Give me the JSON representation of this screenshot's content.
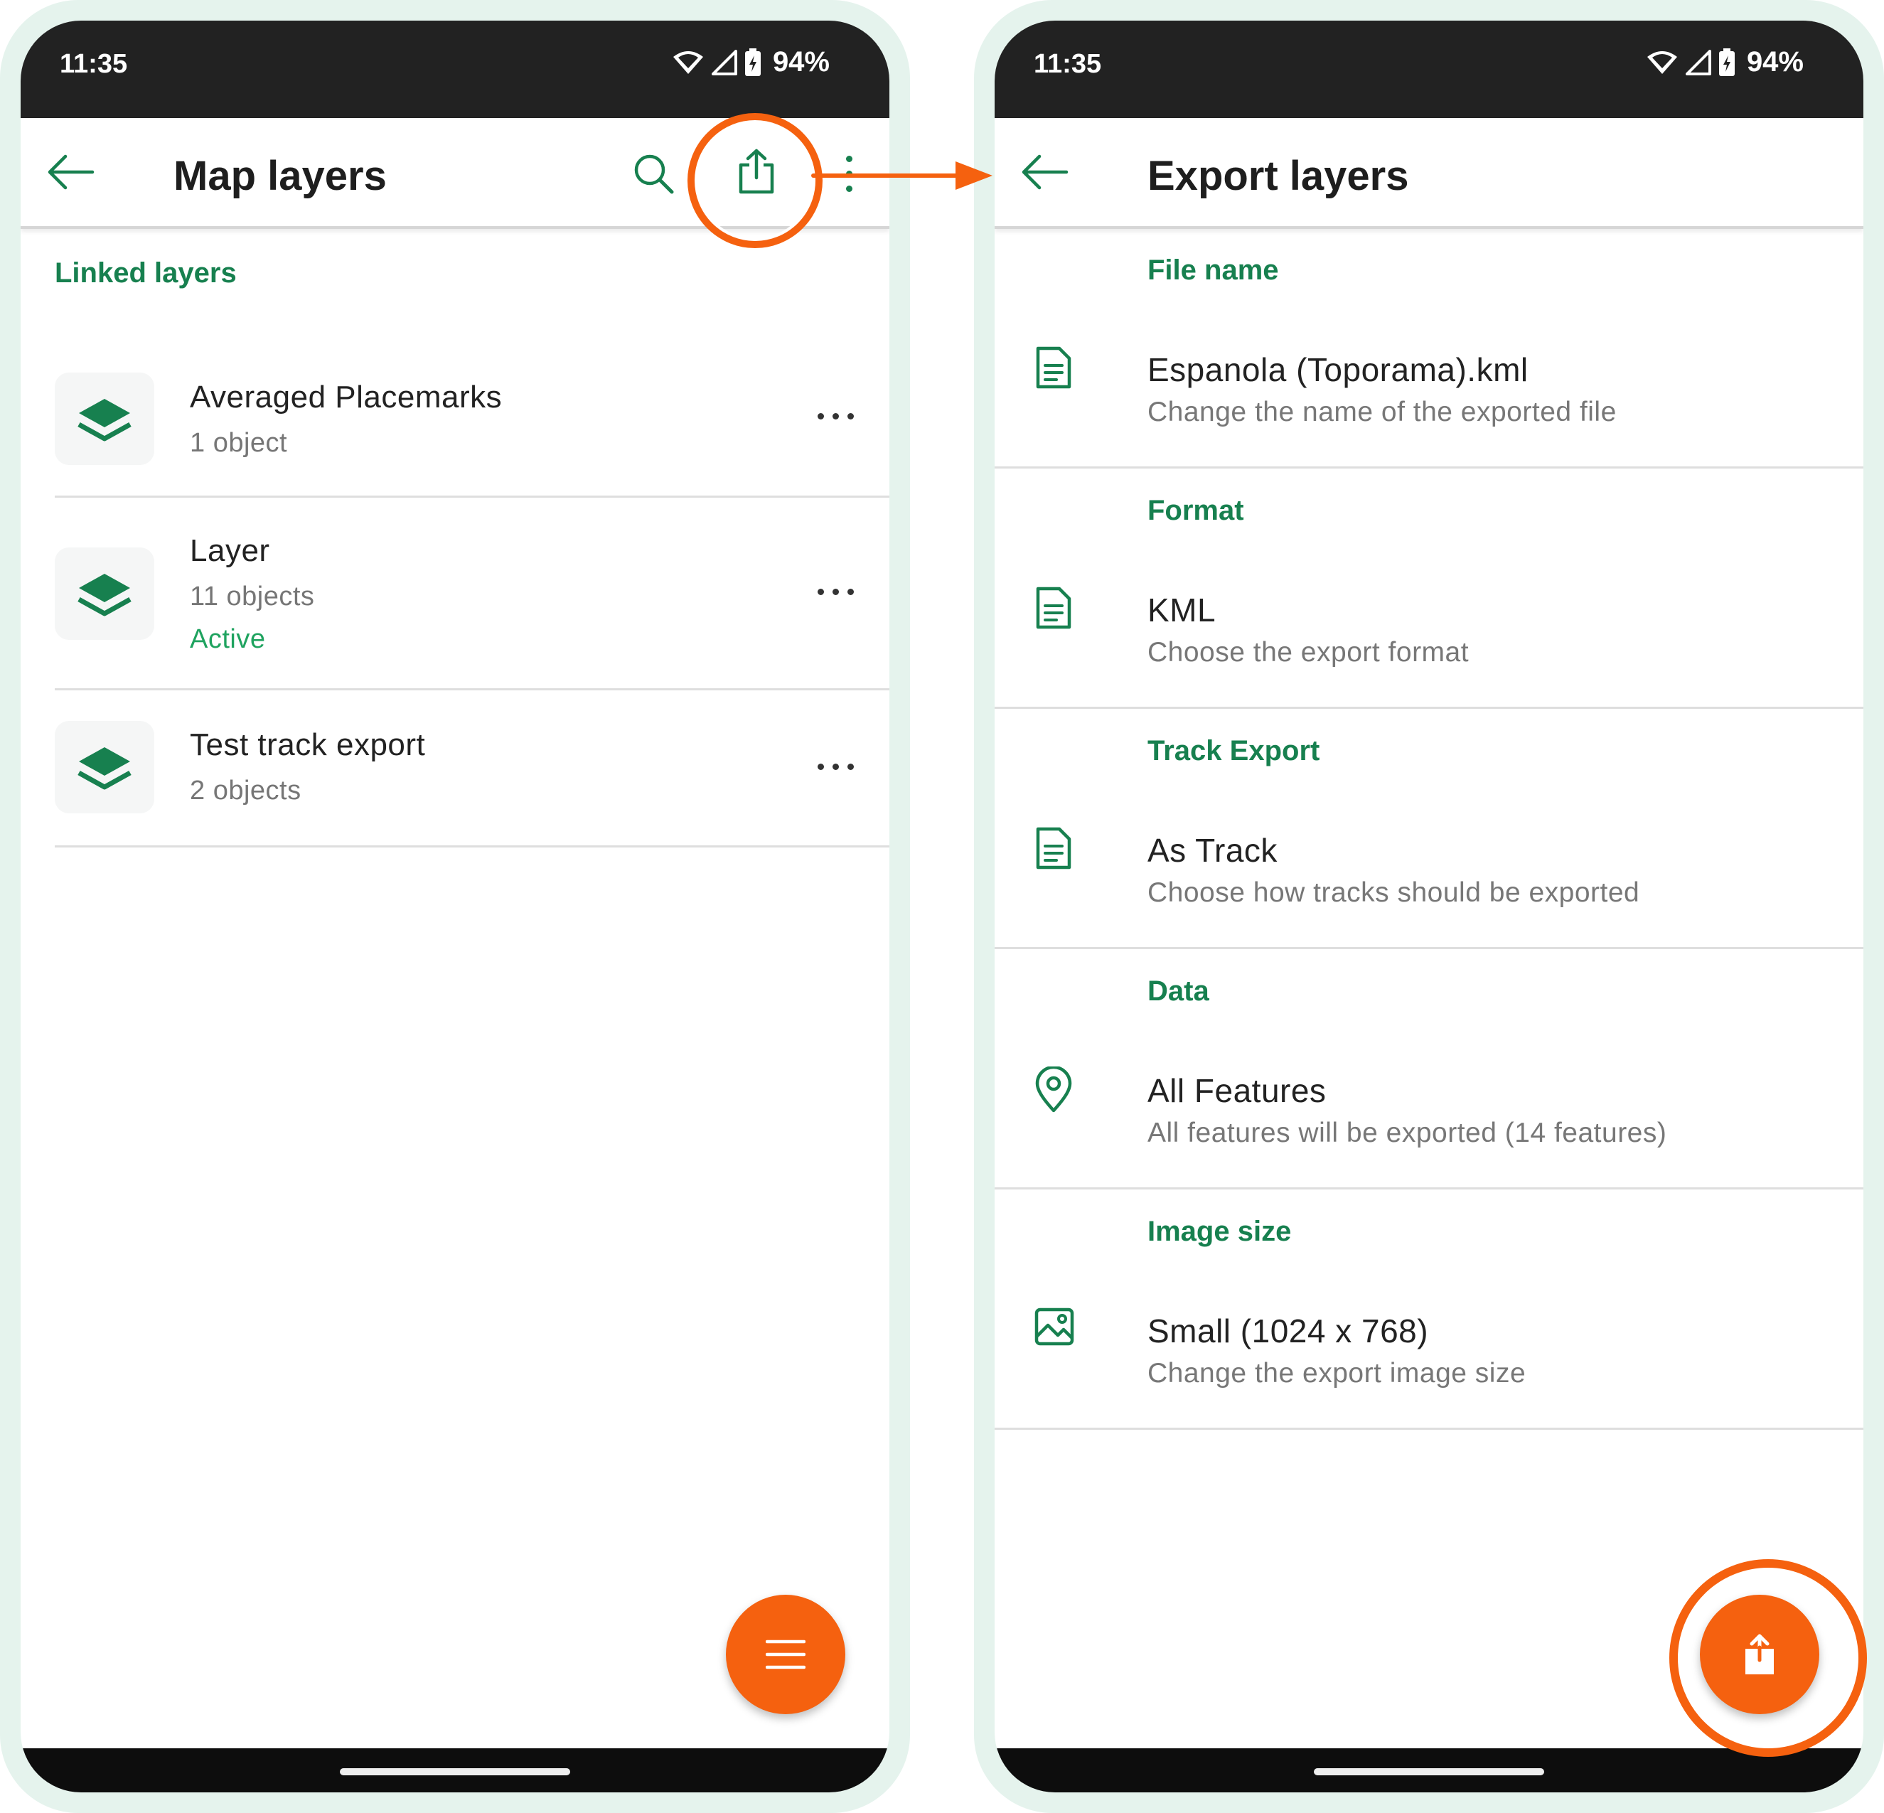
{
  "colors": {
    "accent_green": "#17804f",
    "active_green": "#1fa35f",
    "highlight_orange": "#f5610f",
    "status_bar": "#222222",
    "frame_bg": "#e5f3ed"
  },
  "left": {
    "status": {
      "time": "11:35",
      "battery": "94%",
      "icons": [
        "wifi-icon",
        "signal-icon",
        "battery-icon"
      ]
    },
    "app_bar": {
      "title": "Map layers",
      "back_icon": "arrow-left-icon",
      "actions": [
        "search-icon",
        "share-icon",
        "more-vert-icon"
      ]
    },
    "section_label": "Linked layers",
    "layers": [
      {
        "name": "Averaged Placemarks",
        "count": "1 object",
        "status": ""
      },
      {
        "name": "Layer",
        "count": "11 objects",
        "status": "Active"
      },
      {
        "name": "Test track export",
        "count": "2 objects",
        "status": ""
      }
    ],
    "fab_icon": "menu-icon"
  },
  "right": {
    "status": {
      "time": "11:35",
      "battery": "94%",
      "icons": [
        "wifi-icon",
        "signal-icon",
        "battery-icon"
      ]
    },
    "app_bar": {
      "title": "Export layers",
      "back_icon": "arrow-left-icon"
    },
    "settings": [
      {
        "label": "File name",
        "value": "Espanola (Toporama).kml",
        "sub": "Change the name of the exported file",
        "icon": "document-icon"
      },
      {
        "label": "Format",
        "value": "KML",
        "sub": "Choose the export format",
        "icon": "document-icon"
      },
      {
        "label": "Track Export",
        "value": "As Track",
        "sub": "Choose how tracks should be exported",
        "icon": "document-icon"
      },
      {
        "label": "Data",
        "value": "All Features",
        "sub": "All features will be exported (14 features)",
        "icon": "location-pin-icon"
      },
      {
        "label": "Image size",
        "value": "Small (1024 x 768)",
        "sub": "Change the export image size",
        "icon": "image-icon"
      }
    ],
    "fab_icon": "share-icon"
  }
}
